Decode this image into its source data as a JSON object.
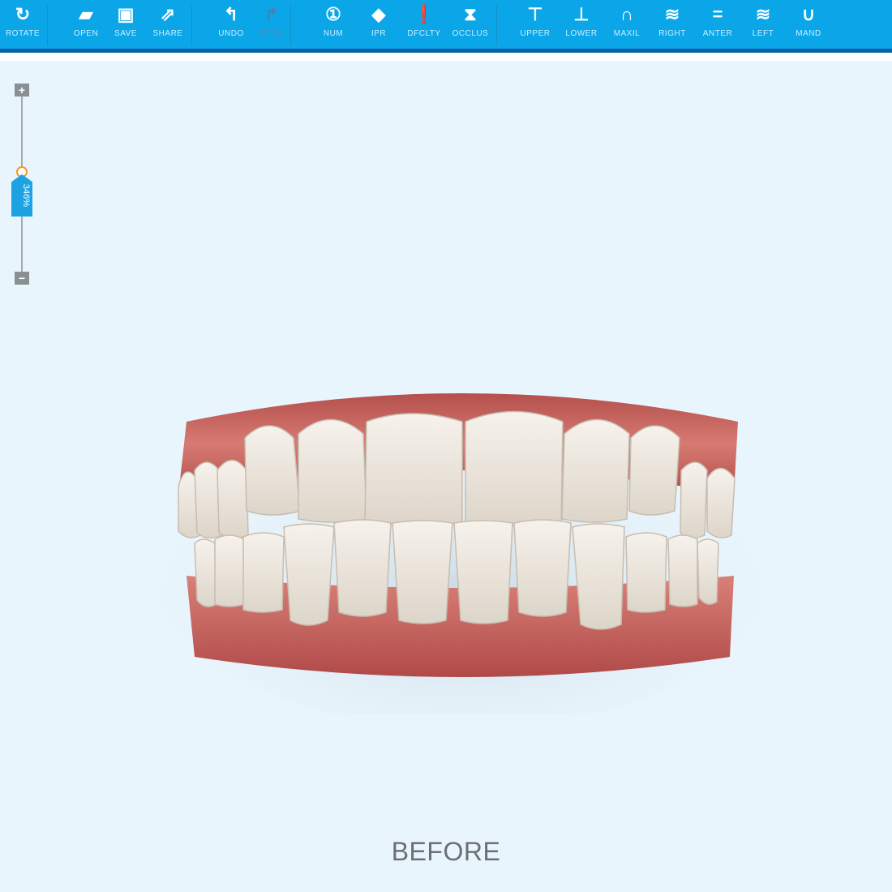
{
  "toolbar": {
    "buttons": [
      {
        "label": "ROTATE",
        "icon": "rotate-icon",
        "glyph": "↻"
      },
      {
        "label": "OPEN",
        "icon": "folder-open-icon",
        "glyph": "▰"
      },
      {
        "label": "SAVE",
        "icon": "floppy-disk-icon",
        "glyph": "▣"
      },
      {
        "label": "SHARE",
        "icon": "share-icon",
        "glyph": "⇗"
      },
      {
        "label": "UNDO",
        "icon": "undo-arrow-icon",
        "glyph": "↰"
      },
      {
        "label": "REDO",
        "icon": "redo-arrow-icon",
        "glyph": "↱",
        "disabled": true
      },
      {
        "label": "NUM",
        "icon": "number-circle-icon",
        "glyph": "①"
      },
      {
        "label": "IPR",
        "icon": "diamond-icon",
        "glyph": "◆"
      },
      {
        "label": "DFCLTY",
        "icon": "exclamation-circle-icon",
        "glyph": "❗"
      },
      {
        "label": "OCCLUS",
        "icon": "occlusion-triangles-icon",
        "glyph": "⧗"
      },
      {
        "label": "UPPER",
        "icon": "upper-jaw-icon",
        "glyph": "⊤"
      },
      {
        "label": "LOWER",
        "icon": "lower-jaw-icon",
        "glyph": "⊥"
      },
      {
        "label": "MAXIL",
        "icon": "maxillary-arch-icon",
        "glyph": "∩"
      },
      {
        "label": "RIGHT",
        "icon": "right-view-icon",
        "glyph": "≋"
      },
      {
        "label": "ANTER",
        "icon": "anterior-view-icon",
        "glyph": "="
      },
      {
        "label": "LEFT",
        "icon": "left-view-icon",
        "glyph": "≋"
      },
      {
        "label": "MAND",
        "icon": "mandibular-arch-icon",
        "glyph": "∪"
      }
    ]
  },
  "zoom": {
    "value": "346%",
    "plus": "+",
    "minus": "−",
    "level_percent": 346
  },
  "viewer": {
    "caption": "BEFORE"
  },
  "colors": {
    "toolbar": "#0ba6e8",
    "toolbar_border": "#0a5fa8",
    "background": "#e9f5fd",
    "gum": "#c9655f",
    "tooth": "#efe9e0",
    "zoom_tag": "#1da3e4",
    "zoom_ring": "#f39a1e"
  }
}
